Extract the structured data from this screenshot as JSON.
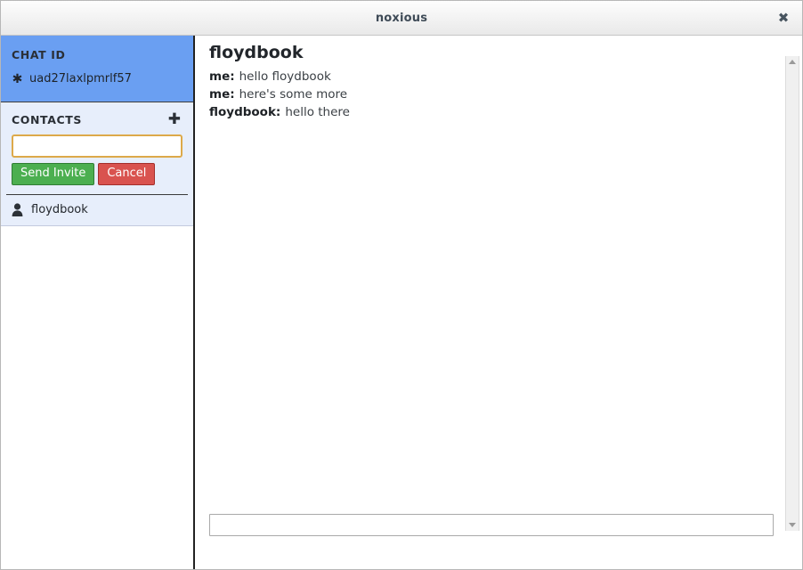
{
  "window": {
    "title": "noxious",
    "close_label": "✖"
  },
  "sidebar": {
    "chat_id": {
      "heading": "CHAT ID",
      "icon": "asterisk-icon",
      "glyph": "✱",
      "value": "uad27laxlpmrlf57"
    },
    "contacts": {
      "heading": "CONTACTS",
      "add_icon": "plus-icon",
      "add_glyph": "✚",
      "invite_input": {
        "value": "",
        "placeholder": ""
      },
      "send_invite_label": "Send Invite",
      "cancel_label": "Cancel",
      "items": [
        {
          "icon": "person-icon",
          "name": "floydbook"
        }
      ]
    }
  },
  "chat": {
    "conversation_title": "floydbook",
    "messages": [
      {
        "sender": "me:",
        "text": "hello floydbook"
      },
      {
        "sender": "me:",
        "text": "here's some more"
      },
      {
        "sender": "floydbook:",
        "text": "hello there"
      }
    ],
    "composer": {
      "value": "",
      "placeholder": ""
    },
    "scrollbar": {
      "up_icon": "scroll-up-arrow-icon",
      "down_icon": "scroll-down-arrow-icon"
    }
  },
  "colors": {
    "chat_id_panel": "#6a9ff2",
    "contacts_panel": "#e7eefb",
    "send_invite": "#4caf50",
    "cancel": "#d9534f",
    "input_focus_border": "#dda94a"
  }
}
